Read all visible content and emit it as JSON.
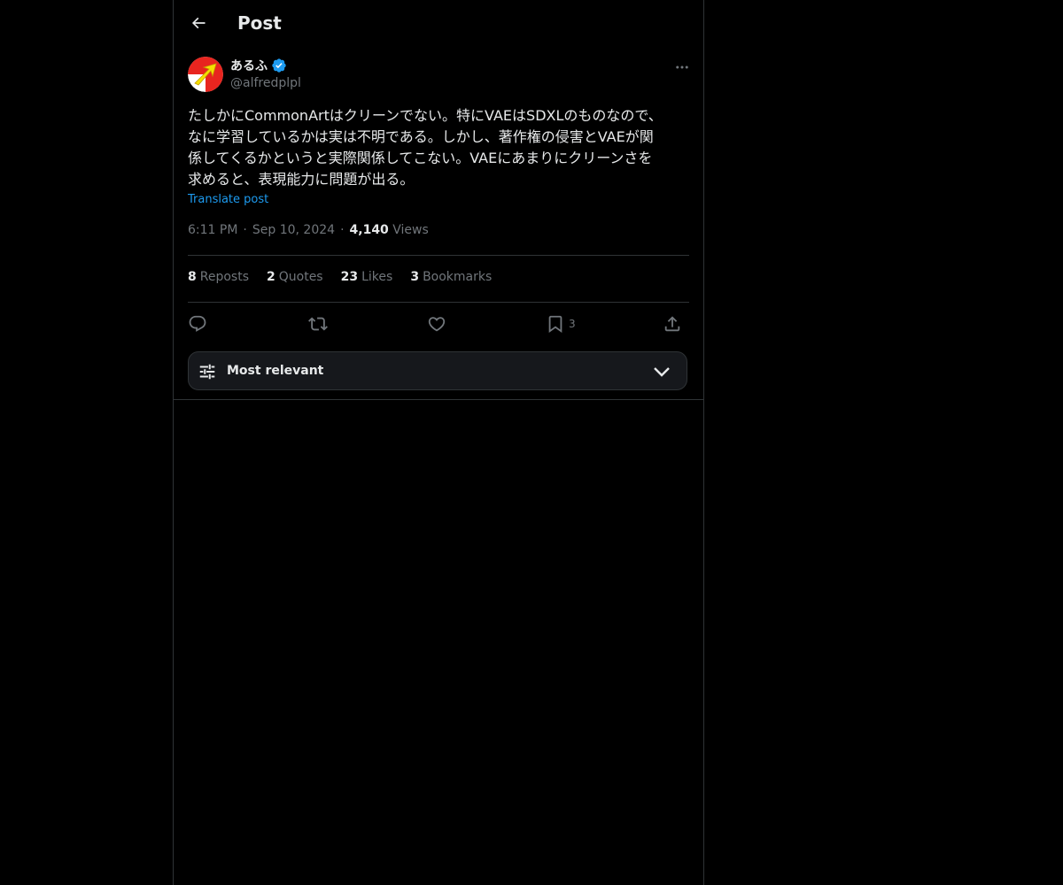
{
  "header": {
    "back_icon": "arrow-left-icon",
    "title": "Post"
  },
  "author": {
    "display_name": "あるふ",
    "handle": "@alfredplpl",
    "verified_icon": "verified-badge-icon",
    "avatar_colors": {
      "primary": "#e8251f",
      "arrow": "#f5e000"
    }
  },
  "post": {
    "text": "たしかにCommonArtはクリーンでない。特にVAEはSDXLのものなので、\nなに学習しているかは実は不明である。しかし、著作権の侵害とVAEが関\n係してくるかというと実際関係してこない。VAEにあまりにクリーンさを\n求めると、表現能力に問題が出る。",
    "translate_label": "Translate post",
    "time": "6:11 PM",
    "date": "Sep 10, 2024",
    "separator": "·",
    "views_count": "4,140",
    "views_label": "Views"
  },
  "stats": {
    "reposts_count": "8",
    "reposts_label": "Reposts",
    "quotes_count": "2",
    "quotes_label": "Quotes",
    "likes_count": "23",
    "likes_label": "Likes",
    "bookmarks_count": "3",
    "bookmarks_label": "Bookmarks"
  },
  "actions": {
    "reply_icon": "reply-icon",
    "repost_icon": "repost-icon",
    "like_icon": "heart-icon",
    "bookmark_icon": "bookmark-icon",
    "bookmark_count": "3",
    "share_icon": "share-icon"
  },
  "sort": {
    "label": "Most relevant",
    "icon": "sliders-icon",
    "chevron": "chevron-down-icon"
  },
  "colors": {
    "background": "#000000",
    "border": "#2f3336",
    "text_primary": "#e7e9ea",
    "text_secondary": "#71767b",
    "accent": "#1d9bf0"
  }
}
